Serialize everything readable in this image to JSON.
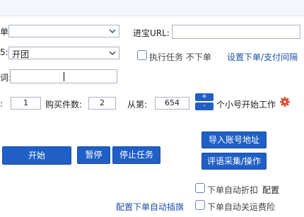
{
  "form": {
    "row1_label_fragment": "单:",
    "row1_select_value": "",
    "url_label": "进宝URL:",
    "url_value": "",
    "row2_label_fragment": "5:",
    "row2_select_value": "开团",
    "exec_task_label": "执行任务 不下单",
    "settings_link": "设置下单/支付间隔",
    "row3_label_fragment": "词:",
    "row3_value": ""
  },
  "counters": {
    "first_label_fragment": ":",
    "first_value": "1",
    "buy_count_label": "购买件数:",
    "buy_count_value": "2",
    "from_label": "从第:",
    "from_value": "654",
    "plus": "+",
    "minus": "-",
    "suffix": "个小号开始工作"
  },
  "actions": {
    "import_button": "导入账号地址",
    "review_button": "评语采集/操作",
    "start_button": "开始",
    "pause_button": "暂停",
    "stop_button": "停止任务"
  },
  "options": {
    "auto_discount_label": "下单自动折扣",
    "auto_discount_config": "配置",
    "auto_insurance_label": "下单自动关运费险",
    "config_flag_link": "配置下单自动插旗"
  },
  "icons": {
    "gear": "gear-icon",
    "gear_color": "#e0442b"
  }
}
